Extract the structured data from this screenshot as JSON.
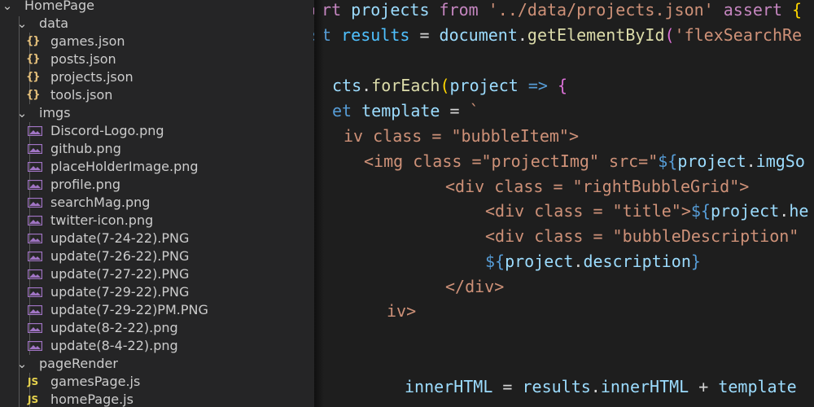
{
  "explorer": {
    "root": "HomePage",
    "folders": [
      {
        "name": "data",
        "files": [
          "games.json",
          "posts.json",
          "projects.json",
          "tools.json"
        ]
      },
      {
        "name": "imgs",
        "files": [
          "Discord-Logo.png",
          "github.png",
          "placeHolderImage.png",
          "profile.png",
          "searchMag.png",
          "twitter-icon.png",
          "update(7-24-22).PNG",
          "update(7-26-22).PNG",
          "update(7-27-22).PNG",
          "update(7-29-22).PNG",
          "update(7-29-22)PM.PNG",
          "update(8-2-22).png",
          "update(8-4-22).png"
        ]
      },
      {
        "name": "pageRender",
        "files": [
          "gamesPage.js",
          "homePage.js"
        ]
      }
    ],
    "icons": {
      "json": "{}",
      "js": "JS"
    }
  },
  "code": {
    "l1": {
      "a": "ort ",
      "b": "projects",
      "c": " from ",
      "d": "'../data/projects.json'",
      "e": " assert ",
      "f": "{"
    },
    "l2": {
      "a": "st ",
      "b": "results",
      "c": " = ",
      "d": "document",
      "e": ".",
      "f": "getElementById",
      "g": "(",
      "h": "'flexSearchRe"
    },
    "l4": {
      "a": "cts",
      "b": ".",
      "c": "forEach",
      "d": "(",
      "e": "project",
      "f": " => ",
      "g": "{"
    },
    "l5": {
      "a": "et ",
      "b": "template",
      "c": " = ",
      "d": "`"
    },
    "l6": {
      "a": "iv class = \"bubbleItem\">"
    },
    "l7": {
      "a": "<img class =\"projectImg\" src=\"",
      "b": "${",
      "c": "project",
      "d": ".",
      "e": "imgSo"
    },
    "l8": {
      "a": "<div class = \"rightBubbleGrid\">"
    },
    "l9": {
      "a": "<div class = \"title\">",
      "b": "${",
      "c": "project",
      "d": ".",
      "e": "he"
    },
    "l10": {
      "a": "<div class = \"bubbleDescription\""
    },
    "l11": {
      "a": "${",
      "b": "project",
      "c": ".",
      "d": "description",
      "e": "}"
    },
    "l12": {
      "a": "</div>"
    },
    "l13": {
      "a": "iv>"
    },
    "l16": {
      "a": "innerHTML",
      "b": " = ",
      "c": "results",
      "d": ".",
      "e": "innerHTML",
      "f": " + ",
      "g": "template"
    }
  },
  "colors": {
    "sidebar": "#252526",
    "editor": "#1e1e1e",
    "keyword": "#569cd6",
    "string": "#ce9178",
    "variable": "#9cdcfe",
    "function": "#dcdcaa"
  }
}
